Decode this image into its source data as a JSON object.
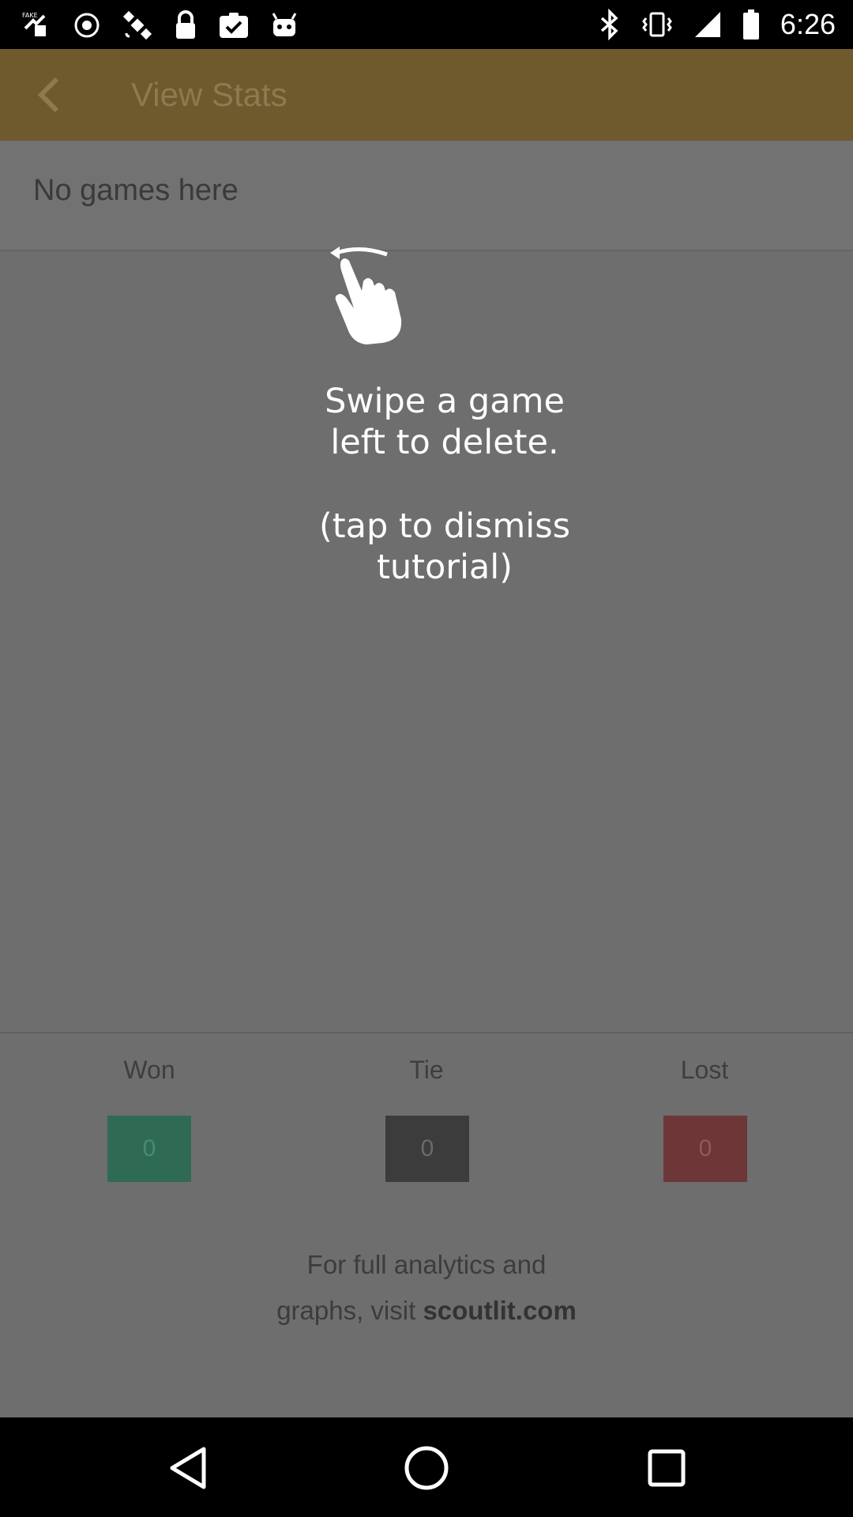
{
  "status_bar": {
    "time": "6:26",
    "left_icons": [
      "fake-gps-icon",
      "sync-icon",
      "satellite-icon",
      "lock-icon",
      "task-check-icon",
      "android-icon"
    ],
    "right_icons": [
      "bluetooth-icon",
      "vibrate-icon",
      "signal-icon",
      "battery-icon"
    ]
  },
  "app_bar": {
    "title": "View Stats",
    "back_icon": "chevron-left-icon",
    "color": "#6e5a2c"
  },
  "list": {
    "empty_text": "No games here"
  },
  "tutorial": {
    "icon": "swipe-hand-icon",
    "line1": "Swipe a game",
    "line2": "left to delete.",
    "line3": "(tap to dismiss",
    "line4": "tutorial)"
  },
  "stats": {
    "won": {
      "label": "Won",
      "value": "0",
      "color": "#2f6a54"
    },
    "tie": {
      "label": "Tie",
      "value": "0",
      "color": "#3c3c3c"
    },
    "lost": {
      "label": "Lost",
      "value": "0",
      "color": "#6e3737"
    }
  },
  "footer": {
    "line1": "For full analytics and",
    "line2_prefix": "graphs, visit ",
    "link": "scoutlit.com"
  },
  "nav_bar": {
    "icons": [
      "back-triangle-icon",
      "home-circle-icon",
      "recents-square-icon"
    ]
  }
}
